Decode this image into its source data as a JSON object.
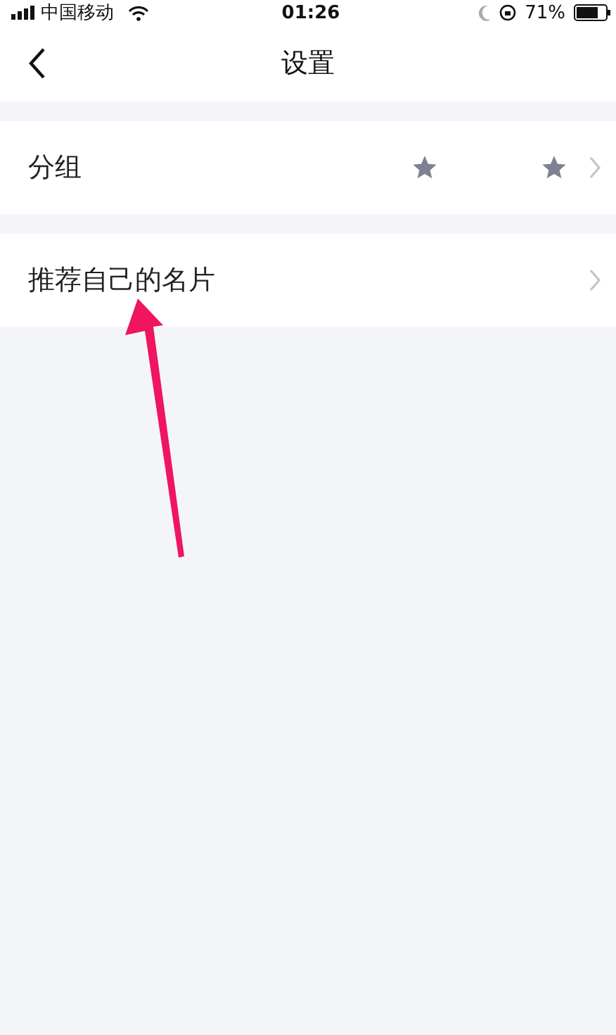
{
  "status_bar": {
    "carrier": "中国移动",
    "time": "01:26",
    "battery": "71%"
  },
  "nav": {
    "title": "设置"
  },
  "sections": [
    {
      "label": "分组",
      "kind": "stars"
    },
    {
      "label": "推荐自己的名片",
      "kind": "plain"
    }
  ]
}
